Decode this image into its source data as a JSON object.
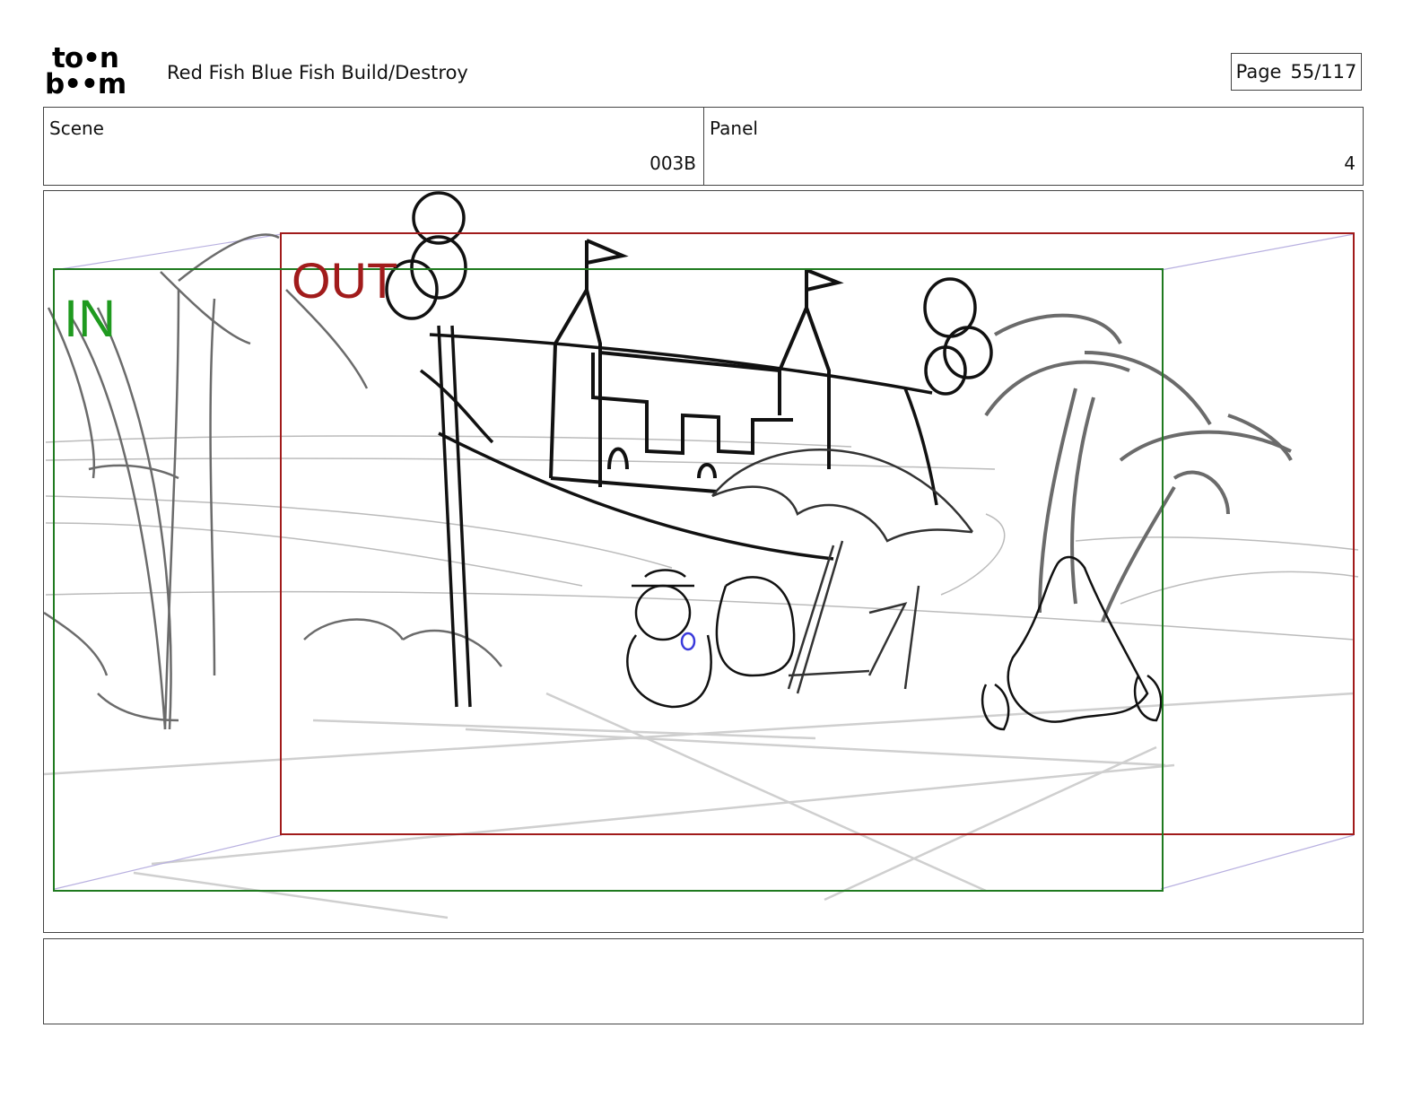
{
  "logo": {
    "line1": "to•n",
    "line2": "b••m",
    "name": "toon-boom-logo"
  },
  "header": {
    "title": "Red Fish Blue Fish  Build/Destroy",
    "page_label": "Page",
    "page_value": "55/117"
  },
  "info": {
    "scene_label": "Scene",
    "scene_value": "003B",
    "panel_label": "Panel",
    "panel_value": "4"
  },
  "frame": {
    "in_label": "IN",
    "out_label": "OUT",
    "in_color": "#1f8a1f",
    "out_color": "#a11b1b"
  },
  "notes": {
    "text": ""
  }
}
